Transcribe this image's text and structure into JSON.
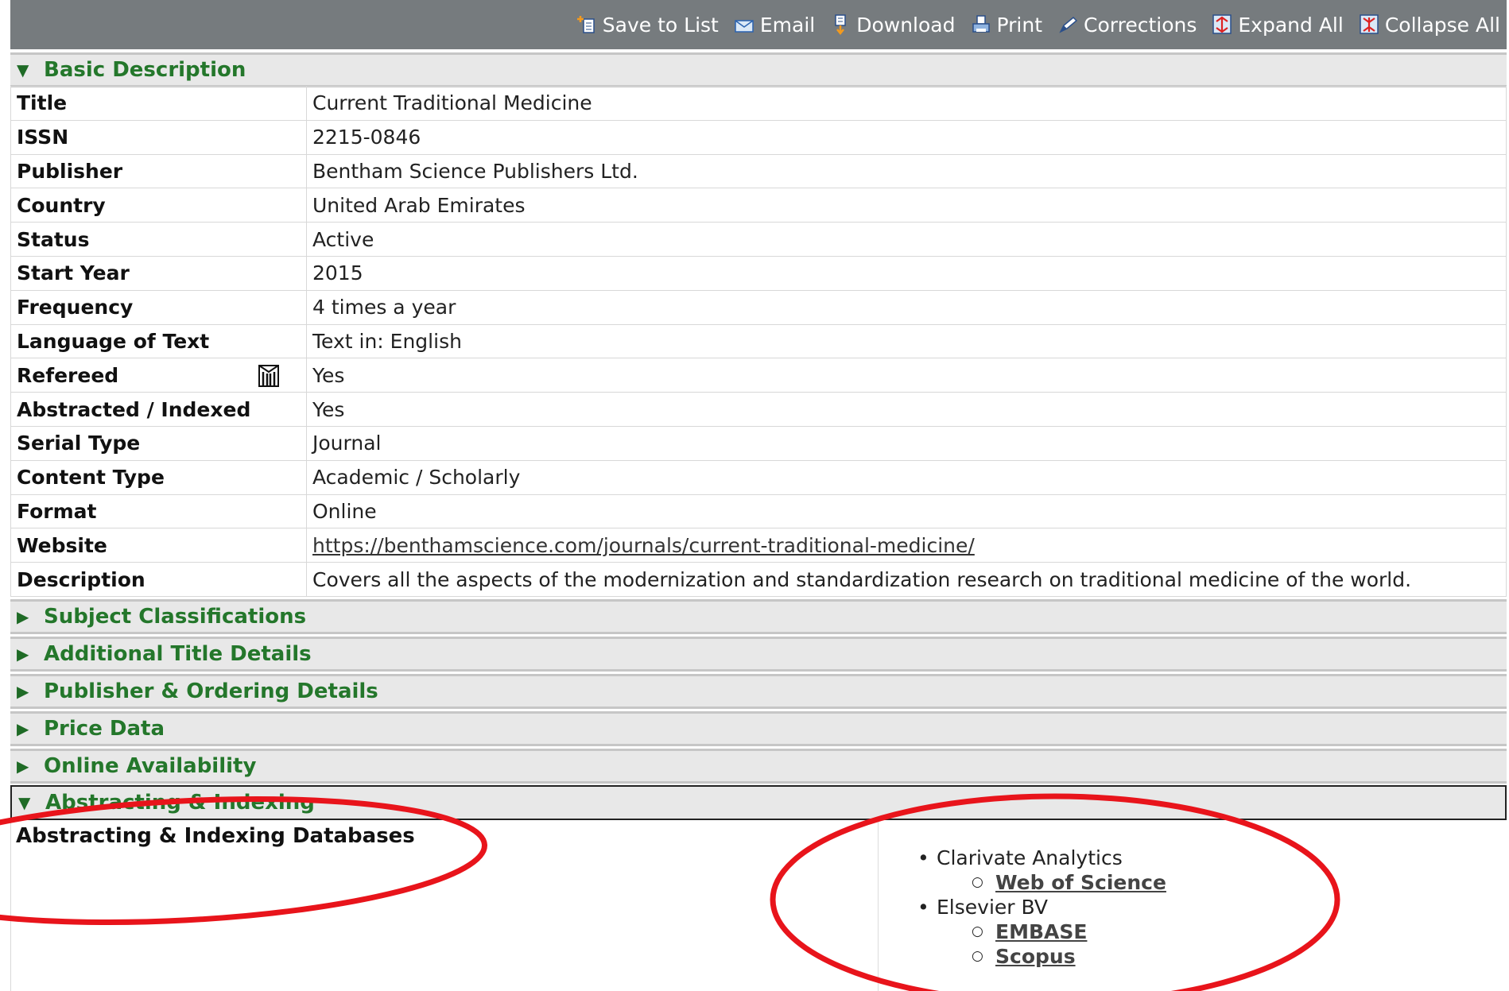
{
  "toolbar": {
    "items": [
      {
        "label": "Save to List",
        "icon": "save-to-list-icon"
      },
      {
        "label": "Email",
        "icon": "email-icon"
      },
      {
        "label": "Download",
        "icon": "download-icon"
      },
      {
        "label": "Print",
        "icon": "print-icon"
      },
      {
        "label": "Corrections",
        "icon": "corrections-icon"
      },
      {
        "label": "Expand All",
        "icon": "expand-all-icon"
      },
      {
        "label": "Collapse All",
        "icon": "collapse-all-icon"
      }
    ]
  },
  "basic": {
    "header": "Basic Description",
    "rows": [
      {
        "label": "Title",
        "value": "Current Traditional Medicine"
      },
      {
        "label": "ISSN",
        "value": "2215-0846"
      },
      {
        "label": "Publisher",
        "value": "Bentham Science Publishers Ltd."
      },
      {
        "label": "Country",
        "value": "United Arab Emirates"
      },
      {
        "label": "Status",
        "value": "Active"
      },
      {
        "label": "Start Year",
        "value": "2015"
      },
      {
        "label": "Frequency",
        "value": "4 times a year"
      },
      {
        "label": "Language of Text",
        "value": "Text in: English"
      },
      {
        "label": "Refereed",
        "value": "Yes"
      },
      {
        "label": "Abstracted / Indexed",
        "value": "Yes"
      },
      {
        "label": "Serial Type",
        "value": "Journal"
      },
      {
        "label": "Content Type",
        "value": "Academic / Scholarly"
      },
      {
        "label": "Format",
        "value": "Online"
      },
      {
        "label": "Website",
        "value": "https://benthamscience.com/journals/current-traditional-medicine/"
      },
      {
        "label": "Description",
        "value": "Covers all the aspects of the modernization and standardization research on traditional medicine of the world."
      }
    ]
  },
  "sections": [
    {
      "label": "Subject Classifications"
    },
    {
      "label": "Additional Title Details"
    },
    {
      "label": "Publisher & Ordering Details"
    },
    {
      "label": "Price Data"
    },
    {
      "label": "Online Availability"
    }
  ],
  "abstracting": {
    "header": "Abstracting & Indexing",
    "label": "Abstracting & Indexing Databases",
    "orgs": [
      {
        "name": "Clarivate Analytics",
        "databases": [
          "Web of Science"
        ]
      },
      {
        "name": "Elsevier BV",
        "databases": [
          "EMBASE",
          "Scopus"
        ]
      }
    ]
  },
  "colors": {
    "toolbar_bg": "#767b7e",
    "section_text": "#24772b",
    "annotation": "#e8141b"
  }
}
